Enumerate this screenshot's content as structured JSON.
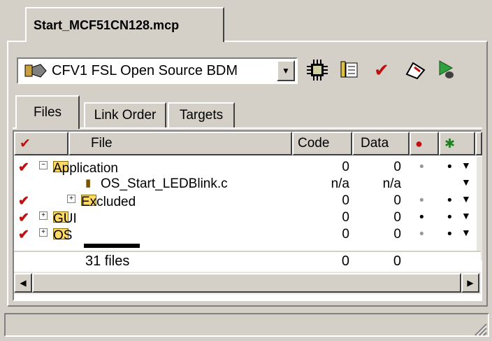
{
  "window": {
    "tab_title": "Start_MCF51CN128.mcp"
  },
  "toolbar": {
    "target": "CFV1 FSL Open Source BDM",
    "icons": [
      "target-settings-icon",
      "chip-icon",
      "file-info-icon",
      "check-icon",
      "debug-icon",
      "run-icon"
    ]
  },
  "tabs": [
    "Files",
    "Link Order",
    "Targets"
  ],
  "columns": {
    "file": "File",
    "code": "Code",
    "data": "Data"
  },
  "rows": [
    {
      "name": "Application",
      "code": "0",
      "data": "0"
    },
    {
      "name": "OS_Start_LEDBlink.c",
      "code": "n/a",
      "data": "n/a"
    },
    {
      "name": "Excluded",
      "code": "0",
      "data": "0"
    },
    {
      "name": "GUI",
      "code": "0",
      "data": "0"
    },
    {
      "name": "OS",
      "code": "0",
      "data": "0"
    }
  ],
  "footer": {
    "files": "31 files",
    "code_total": "0",
    "data_total": "0"
  },
  "colors": {
    "check": "#c01010",
    "folder": "#ffd966"
  }
}
